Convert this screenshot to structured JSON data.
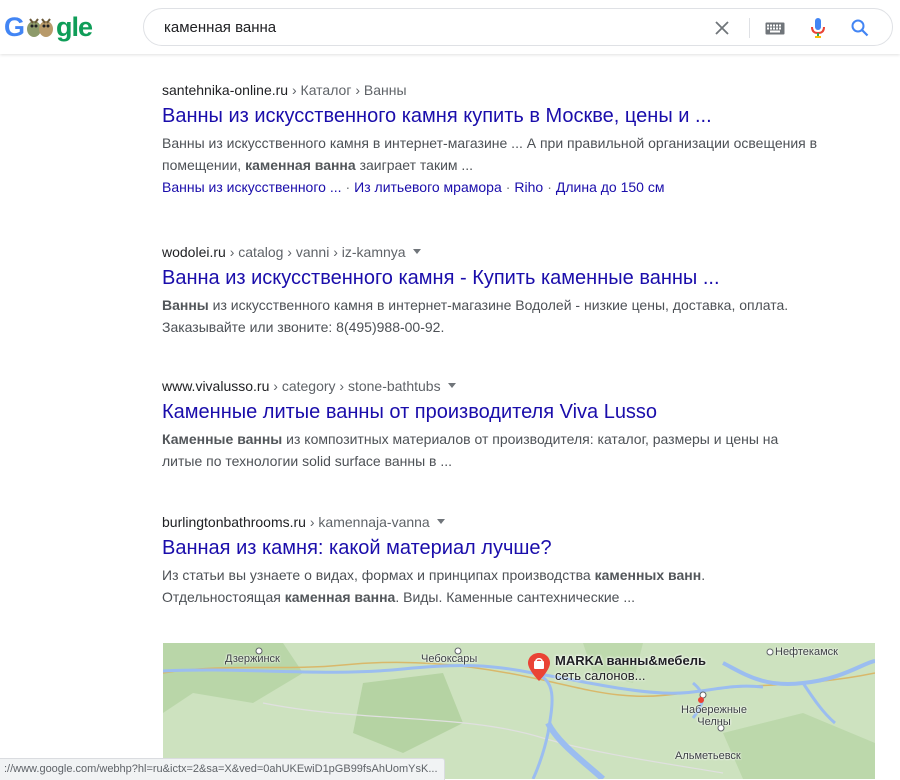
{
  "header": {
    "logo_letters": [
      "G",
      "gle"
    ],
    "search": {
      "value": "каменная ванна",
      "placeholder": ""
    },
    "icons": [
      "close-icon",
      "keyboard-icon",
      "microphone-icon",
      "search-icon"
    ]
  },
  "results": [
    {
      "domain": "santehnika-online.ru",
      "path": " › Каталог › Ванны",
      "has_menu": false,
      "title": "Ванны из искусственного камня купить в Москве, цены и ...",
      "snippet_parts": [
        {
          "t": "Ванны из искусственного камня в интернет-магазине ... А при правильной организации освещения в помещении, ",
          "b": false
        },
        {
          "t": "каменная ванна",
          "b": true
        },
        {
          "t": " заиграет таким ...",
          "b": false
        }
      ],
      "sitelinks": [
        "Ванны из искусственного ...",
        "Из литьевого мрамора",
        "Riho",
        "Длина до 150 см"
      ]
    },
    {
      "domain": "wodolei.ru",
      "path": " › catalog › vanni › iz-kamnya",
      "has_menu": true,
      "title": "Ванна из искусственного камня - Купить каменные ванны ...",
      "snippet_parts": [
        {
          "t": "Ванны",
          "b": true
        },
        {
          "t": " из искусственного камня в интернет-магазине Водолей - низкие цены, доставка, оплата. Заказывайте или звоните: 8(495)988-00-92.",
          "b": false
        }
      ],
      "sitelinks": []
    },
    {
      "domain": "www.vivalusso.ru",
      "path": " › category › stone-bathtubs",
      "has_menu": true,
      "title": "Каменные литые ванны от производителя Viva Lusso",
      "snippet_parts": [
        {
          "t": "Каменные ванны",
          "b": true
        },
        {
          "t": " из композитных материалов от производителя: каталог, размеры и цены на литые по технологии solid surface ванны в ...",
          "b": false
        }
      ],
      "sitelinks": []
    },
    {
      "domain": "burlingtonbathrooms.ru",
      "path": " › kamennaja-vanna",
      "has_menu": true,
      "title": "Ванная из камня: какой материал лучше?",
      "snippet_parts": [
        {
          "t": "Из статьи вы узнаете о видах, формах и принципах производства ",
          "b": false
        },
        {
          "t": "каменных ванн",
          "b": true
        },
        {
          "t": ". Отдельностоящая ",
          "b": false
        },
        {
          "t": "каменная ванна",
          "b": true
        },
        {
          "t": ". Виды. Каменные сантехнические ...",
          "b": false
        }
      ],
      "sitelinks": []
    }
  ],
  "map": {
    "cities": {
      "dzerzhinsk": "Дзержинск",
      "cheboksary": "Чебоксары",
      "neftekamsk": "Нефтекамск",
      "naberezhnye": "Набережные Челны",
      "almetyevsk": "Альметьевск"
    },
    "pin": {
      "line1": "MARKA ванны&мебель",
      "line2": "сеть салонов..."
    }
  },
  "status_bar": "://www.google.com/webhp?hl=ru&ictx=2&sa=X&ved=0ahUKEwiD1pGB99fsAhUomYsK..."
}
